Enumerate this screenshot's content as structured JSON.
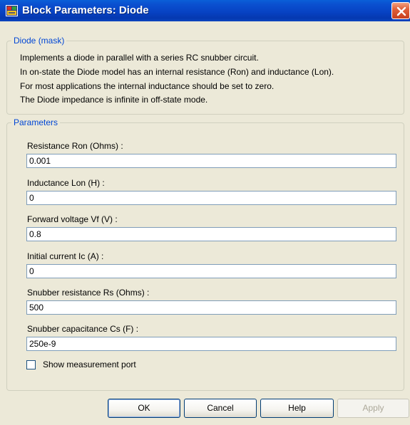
{
  "window": {
    "title": "Block Parameters: Diode"
  },
  "mask": {
    "legend": "Diode (mask)",
    "description": [
      "Implements a diode in parallel with a series RC snubber circuit.",
      "In on-state the Diode model has an internal resistance (Ron) and inductance (Lon).",
      "For most applications the internal inductance should be set to zero.",
      "The Diode impedance is infinite in off-state mode."
    ]
  },
  "parameters": {
    "legend": "Parameters",
    "fields": [
      {
        "label": "Resistance Ron (Ohms) :",
        "value": "0.001"
      },
      {
        "label": "Inductance Lon (H) :",
        "value": "0"
      },
      {
        "label": "Forward voltage Vf (V) :",
        "value": "0.8"
      },
      {
        "label": "Initial current Ic (A) :",
        "value": "0"
      },
      {
        "label": "Snubber resistance Rs (Ohms) :",
        "value": "500"
      },
      {
        "label": "Snubber capacitance Cs (F) :",
        "value": "250e-9"
      }
    ],
    "show_measurement_port": {
      "label": "Show measurement port",
      "checked": false
    }
  },
  "buttons": {
    "ok": "OK",
    "cancel": "Cancel",
    "help": "Help",
    "apply": "Apply"
  },
  "colors": {
    "titlebar": "#0743c4",
    "legend_text": "#0046d5",
    "dialog_bg": "#ece9d8",
    "input_border": "#7f9db9"
  }
}
